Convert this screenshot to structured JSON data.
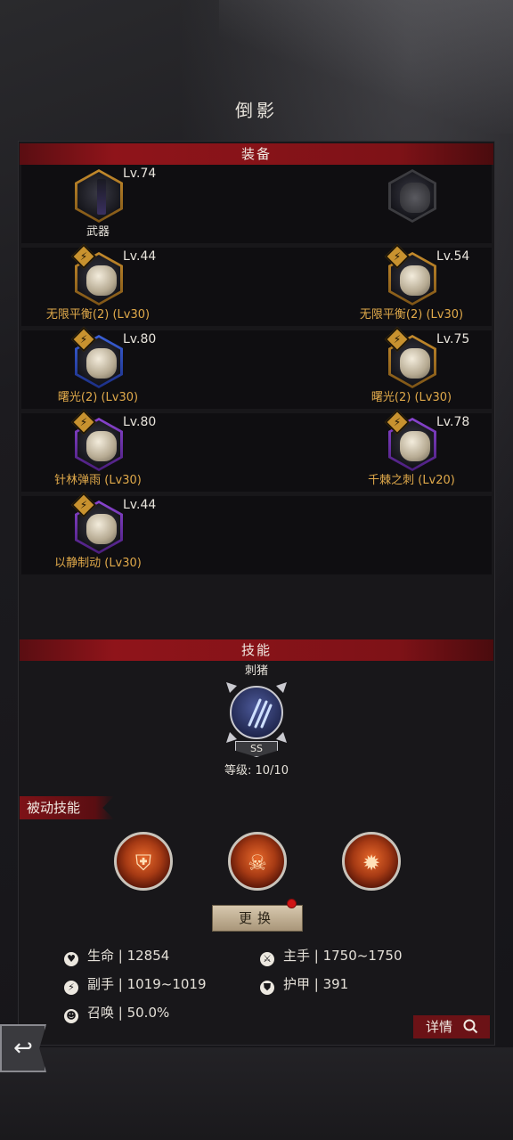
{
  "page": {
    "title": "倒影"
  },
  "equipment": {
    "header": "装备",
    "rows": [
      {
        "left": {
          "level": "Lv.74",
          "name": "武器",
          "frame": "gold",
          "badge": false,
          "icon": "weapon-icon"
        },
        "right": {
          "level": "",
          "name": "",
          "frame": "grey",
          "badge": false,
          "icon": "empty-shield-slot-icon"
        }
      },
      {
        "left": {
          "level": "Lv.44",
          "name": "无限平衡(2) (Lv30)",
          "frame": "gold",
          "badge": true,
          "icon": "helmet-icon"
        },
        "right": {
          "level": "Lv.54",
          "name": "无限平衡(2) (Lv30)",
          "frame": "gold",
          "badge": true,
          "icon": "armor-icon"
        }
      },
      {
        "left": {
          "level": "Lv.80",
          "name": "曙光(2) (Lv30)",
          "frame": "blue",
          "badge": true,
          "icon": "gloves-icon"
        },
        "right": {
          "level": "Lv.75",
          "name": "曙光(2) (Lv30)",
          "frame": "gold",
          "badge": true,
          "icon": "boots-icon"
        }
      },
      {
        "left": {
          "level": "Lv.80",
          "name": "针林弹雨 (Lv30)",
          "frame": "purple",
          "badge": true,
          "icon": "necklace-icon"
        },
        "right": {
          "level": "Lv.78",
          "name": "千棘之刺 (Lv20)",
          "frame": "purple",
          "badge": true,
          "icon": "belt-icon"
        }
      },
      {
        "left": {
          "level": "Lv.44",
          "name": "以静制动 (Lv30)",
          "frame": "purple",
          "badge": true,
          "icon": "cloak-icon"
        },
        "right": null
      }
    ]
  },
  "skill": {
    "header": "技能",
    "name": "刺猪",
    "rank": "SS",
    "level_text": "等级: 10/10",
    "icon": "claw-slash-icon"
  },
  "passive": {
    "label": "被动技能",
    "skills": [
      {
        "icon": "shield-fist-icon"
      },
      {
        "icon": "flaming-skull-icon"
      },
      {
        "icon": "fire-warrior-icon"
      }
    ],
    "swap_label": "更换"
  },
  "stats": {
    "hp": "生命 | 12854",
    "main_hand": "主手 | 1750~1750",
    "off_hand": "副手 | 1019~1019",
    "armor": "护甲 | 391",
    "summon": "召唤 | 50.0%"
  },
  "detail_label": "详情",
  "colors": {
    "accent_red": "#8f141a",
    "gold_text": "#e0a94a",
    "frame_gold": "#c58b2c",
    "frame_blue": "#3a60d8",
    "frame_purple": "#8a45d0"
  }
}
